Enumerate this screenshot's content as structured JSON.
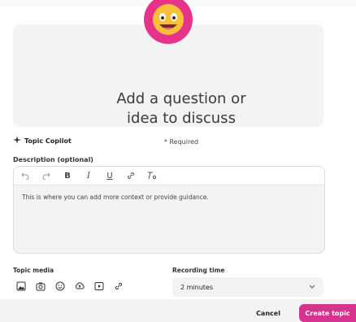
{
  "question": {
    "line1": "Add a question or",
    "line2": "idea to discuss",
    "required": "* Required"
  },
  "copilot": {
    "label": "Topic Copilot",
    "icon": "sparkle-icon"
  },
  "description": {
    "label": "Description (optional)",
    "toolbar": [
      "undo-icon",
      "redo-icon",
      "bold-icon",
      "italic-icon",
      "underline-icon",
      "link-icon",
      "clear-format-icon"
    ],
    "placeholder": "This is where you can add more context or provide guidance."
  },
  "media": {
    "label": "Topic media",
    "icons": [
      "image-icon",
      "camera-icon",
      "emoji-icon",
      "upload-icon",
      "video-icon",
      "link-icon"
    ]
  },
  "recording": {
    "label": "Recording time",
    "value": "2 minutes"
  },
  "footer": {
    "cancel": "Cancel",
    "create": "Create topic"
  },
  "colors": {
    "accent": "#d6338f",
    "emoji_bg": "#e8338a",
    "panel": "#f3f3f3"
  }
}
